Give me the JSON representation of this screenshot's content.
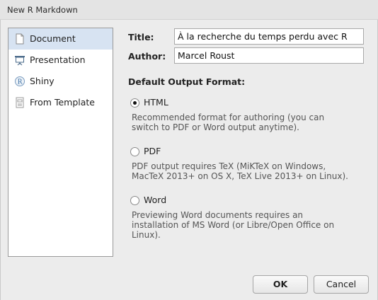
{
  "window": {
    "title": "New R Markdown"
  },
  "sidebar": {
    "items": [
      {
        "label": "Document",
        "icon": "document-icon",
        "selected": true
      },
      {
        "label": "Presentation",
        "icon": "presentation-icon",
        "selected": false
      },
      {
        "label": "Shiny",
        "icon": "shiny-r-icon",
        "selected": false
      },
      {
        "label": "From Template",
        "icon": "template-icon",
        "selected": false
      }
    ]
  },
  "form": {
    "title_label": "Title:",
    "title_value": "À la recherche du temps perdu avec R",
    "author_label": "Author:",
    "author_value": "Marcel Roust",
    "output_heading": "Default Output Format:",
    "options": [
      {
        "label": "HTML",
        "checked": true,
        "desc1": "Recommended format for authoring (you can",
        "desc2": "switch to PDF or Word output anytime)."
      },
      {
        "label": "PDF",
        "checked": false,
        "desc1": "PDF output requires TeX (MiKTeX on Windows,",
        "desc2": "MacTeX 2013+ on OS X, TeX Live 2013+ on Linux)."
      },
      {
        "label": "Word",
        "checked": false,
        "desc1": "Previewing Word documents requires an",
        "desc2": "installation of MS Word (or Libre/Open Office on",
        "desc3": "Linux)."
      }
    ]
  },
  "buttons": {
    "ok": "OK",
    "cancel": "Cancel"
  },
  "colors": {
    "selection": "#d7e3f2",
    "window_bg": "#ececec"
  }
}
